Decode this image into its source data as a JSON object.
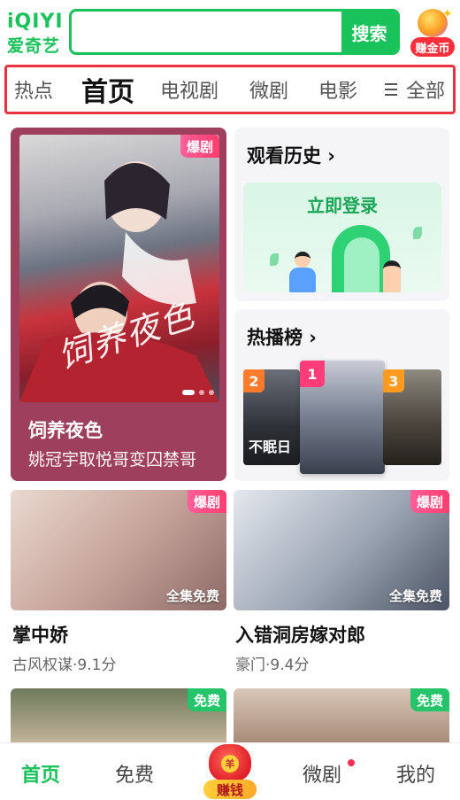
{
  "header": {
    "logo_en": "iQIYI",
    "logo_cn": "爱奇艺",
    "search_placeholder": "",
    "search_button": "搜索",
    "earn_coin_label": "赚金币"
  },
  "nav": {
    "tabs": [
      {
        "label": "热点",
        "active": false
      },
      {
        "label": "首页",
        "active": true
      },
      {
        "label": "电视剧",
        "active": false
      },
      {
        "label": "微剧",
        "active": false
      },
      {
        "label": "电影",
        "active": false
      }
    ],
    "all_label": "全部"
  },
  "feature": {
    "badge": "爆剧",
    "poster_text": "饲养夜色",
    "title": "饲养夜色",
    "subtitle": "姚冠宇取悦哥变囚禁哥"
  },
  "history": {
    "title": "观看历史 ›",
    "login_label": "立即登录"
  },
  "ranking": {
    "title": "热播榜 ›",
    "items": [
      {
        "rank": "2",
        "caption": "不眠日"
      },
      {
        "rank": "1",
        "caption": ""
      },
      {
        "rank": "3",
        "caption": ""
      }
    ]
  },
  "cards": [
    {
      "badge": "爆剧",
      "overlay": "全集免费",
      "title": "掌中娇",
      "subtitle": "古风权谋·9.1分"
    },
    {
      "badge": "爆剧",
      "overlay": "全集免费",
      "title": "入错洞房嫁对郎",
      "subtitle": "豪门·9.4分"
    },
    {
      "badge": "免费",
      "overlay": "",
      "title": "",
      "subtitle": ""
    },
    {
      "badge": "免费",
      "overlay": "",
      "title": "",
      "subtitle": ""
    }
  ],
  "bottom_nav": {
    "home": "首页",
    "free": "免费",
    "earn": "赚钱",
    "earn_coin_glyph": "羊",
    "micro": "微剧",
    "mine": "我的"
  },
  "colors": {
    "brand_green": "#19c25a",
    "highlight_red": "#e8323f",
    "hot_badge": "#ff3c6d",
    "free_badge": "#25c46a"
  },
  "icons": [
    "menu-icon",
    "earn-coin-icon",
    "money-bag-icon",
    "chevron-right-icon"
  ]
}
